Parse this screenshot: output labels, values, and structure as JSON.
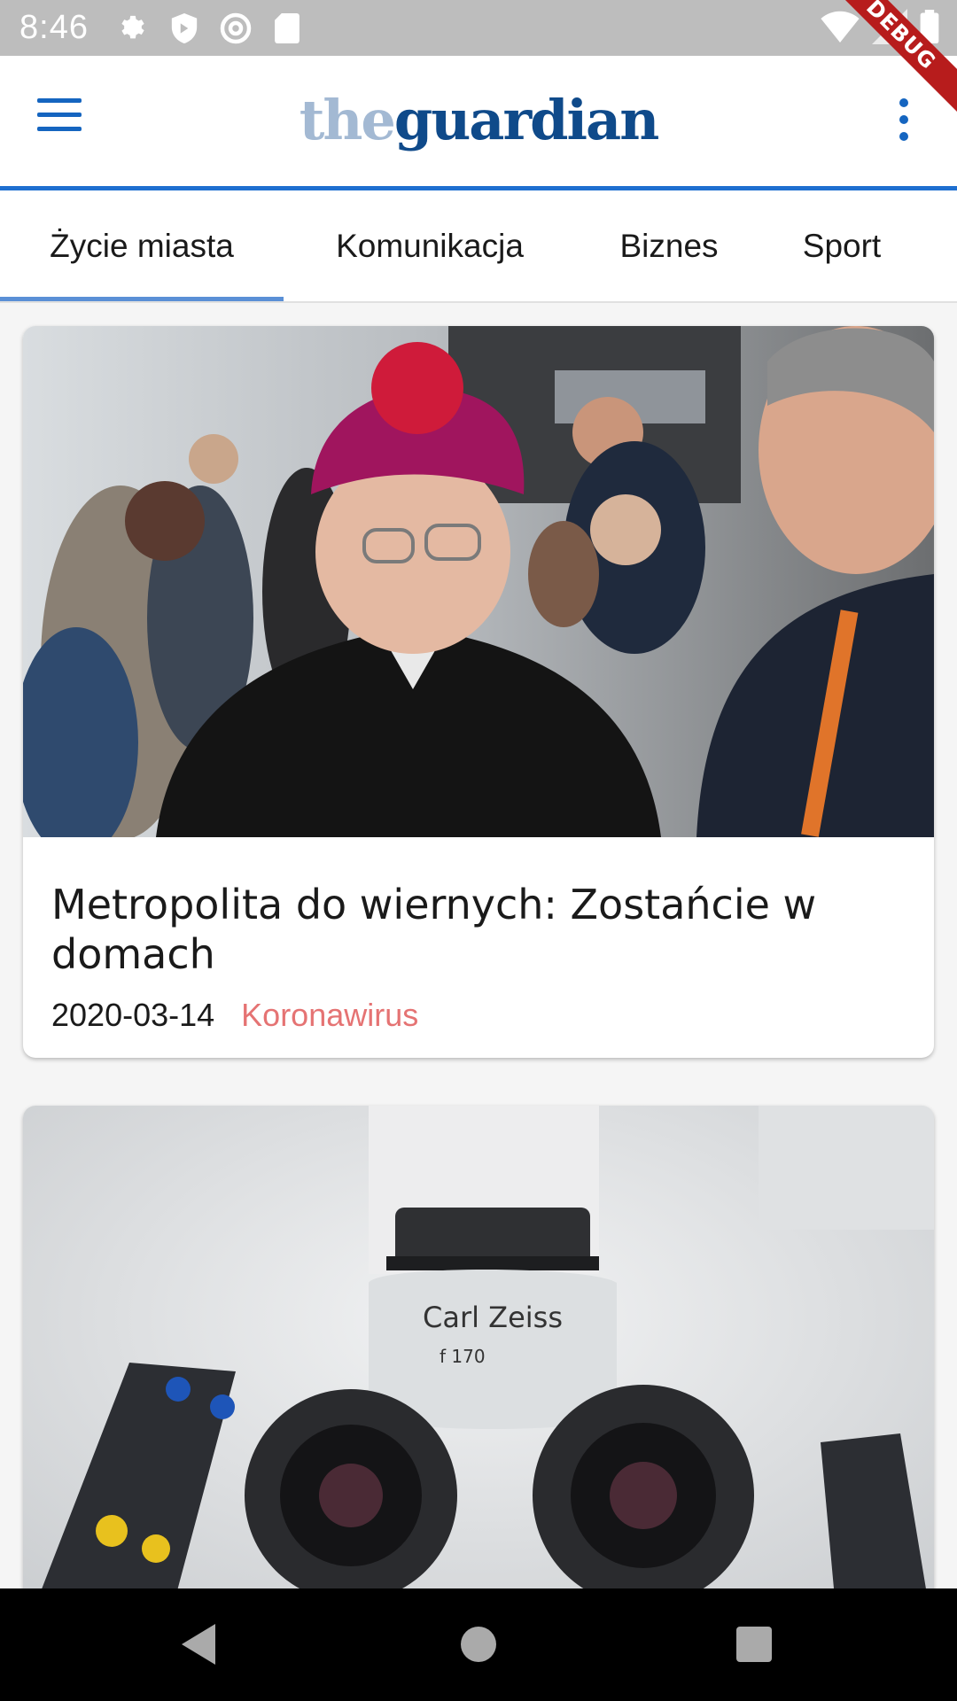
{
  "status_bar": {
    "time": "8:46",
    "icons": [
      "settings-icon",
      "shield-icon",
      "at-sign-icon",
      "sd-card-icon",
      "wifi-icon",
      "signal-icon",
      "battery-icon"
    ],
    "debug_label": "DEBUG"
  },
  "app_bar": {
    "logo_the": "the",
    "logo_guardian": "guardian",
    "accent_color": "#1e6fd0"
  },
  "tabs": [
    {
      "label": "Życie miasta",
      "selected": true
    },
    {
      "label": "Komunikacja",
      "selected": false
    },
    {
      "label": "Biznes",
      "selected": false
    },
    {
      "label": "Sport",
      "selected": false
    }
  ],
  "articles": [
    {
      "title": "Metropolita do wiernych: Zostańcie w domach",
      "date": "2020-03-14",
      "tag": "Koronawirus",
      "image_alt": "bishop-in-crowd-photo"
    },
    {
      "image_text_brand": "Carl  Zeiss",
      "image_text_model": "f 170",
      "image_alt": "microscope-photo"
    }
  ],
  "nav_bar": {
    "buttons": [
      "back-icon",
      "home-icon",
      "recents-icon"
    ]
  }
}
